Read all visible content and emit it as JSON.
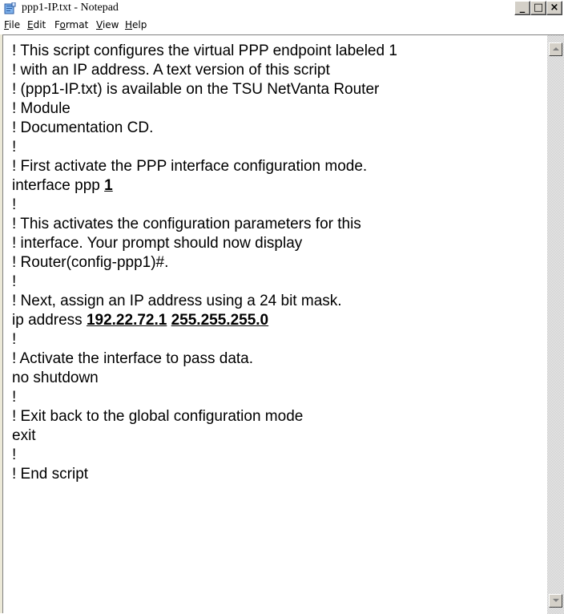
{
  "window": {
    "title": "ppp1-IP.txt - Notepad",
    "controls": {
      "minimize": "_",
      "maximize": "□",
      "close": "×"
    }
  },
  "menubar": {
    "items": [
      {
        "pre": "",
        "accel": "F",
        "post": "ile"
      },
      {
        "pre": "",
        "accel": "E",
        "post": "dit"
      },
      {
        "pre": "F",
        "accel": "o",
        "post": "rmat"
      },
      {
        "pre": "",
        "accel": "V",
        "post": "iew"
      },
      {
        "pre": "",
        "accel": "H",
        "post": "elp"
      }
    ]
  },
  "document": {
    "lines": [
      {
        "text": "! This script configures the virtual PPP endpoint labeled 1"
      },
      {
        "text": "! with an IP address. A text version of this script"
      },
      {
        "text": "! (ppp1-IP.txt) is available on the TSU NetVanta Router"
      },
      {
        "text": "! Module"
      },
      {
        "text": "! Documentation CD."
      },
      {
        "text": "!"
      },
      {
        "text": "! First activate the PPP interface configuration mode."
      },
      {
        "prefix": "interface ppp ",
        "highlight": "1"
      },
      {
        "text": "!"
      },
      {
        "text": "! This activates the configuration parameters for this"
      },
      {
        "text": "! interface. Your prompt should now display"
      },
      {
        "text": "! Router(config-ppp1)#."
      },
      {
        "text": "!"
      },
      {
        "text": "! Next, assign an IP address using a 24 bit mask."
      },
      {
        "prefix": "ip address ",
        "highlight": "192.22.72.1",
        "middle": " ",
        "highlight2": "255.255.255.0"
      },
      {
        "text": "!"
      },
      {
        "text": "! Activate the interface to pass data."
      },
      {
        "text": "no shutdown"
      },
      {
        "text": "!"
      },
      {
        "text": "! Exit back to the global configuration mode"
      },
      {
        "text": "exit"
      },
      {
        "text": "!"
      },
      {
        "text": "! End script"
      }
    ]
  },
  "colors": {
    "title_icon_blue": "#3a78c8",
    "chrome": "#d4d0c8",
    "text": "#000000"
  },
  "icons": {
    "app": "notepad-icon",
    "scroll_up": "arrow-up-icon",
    "scroll_down": "arrow-down-icon"
  }
}
